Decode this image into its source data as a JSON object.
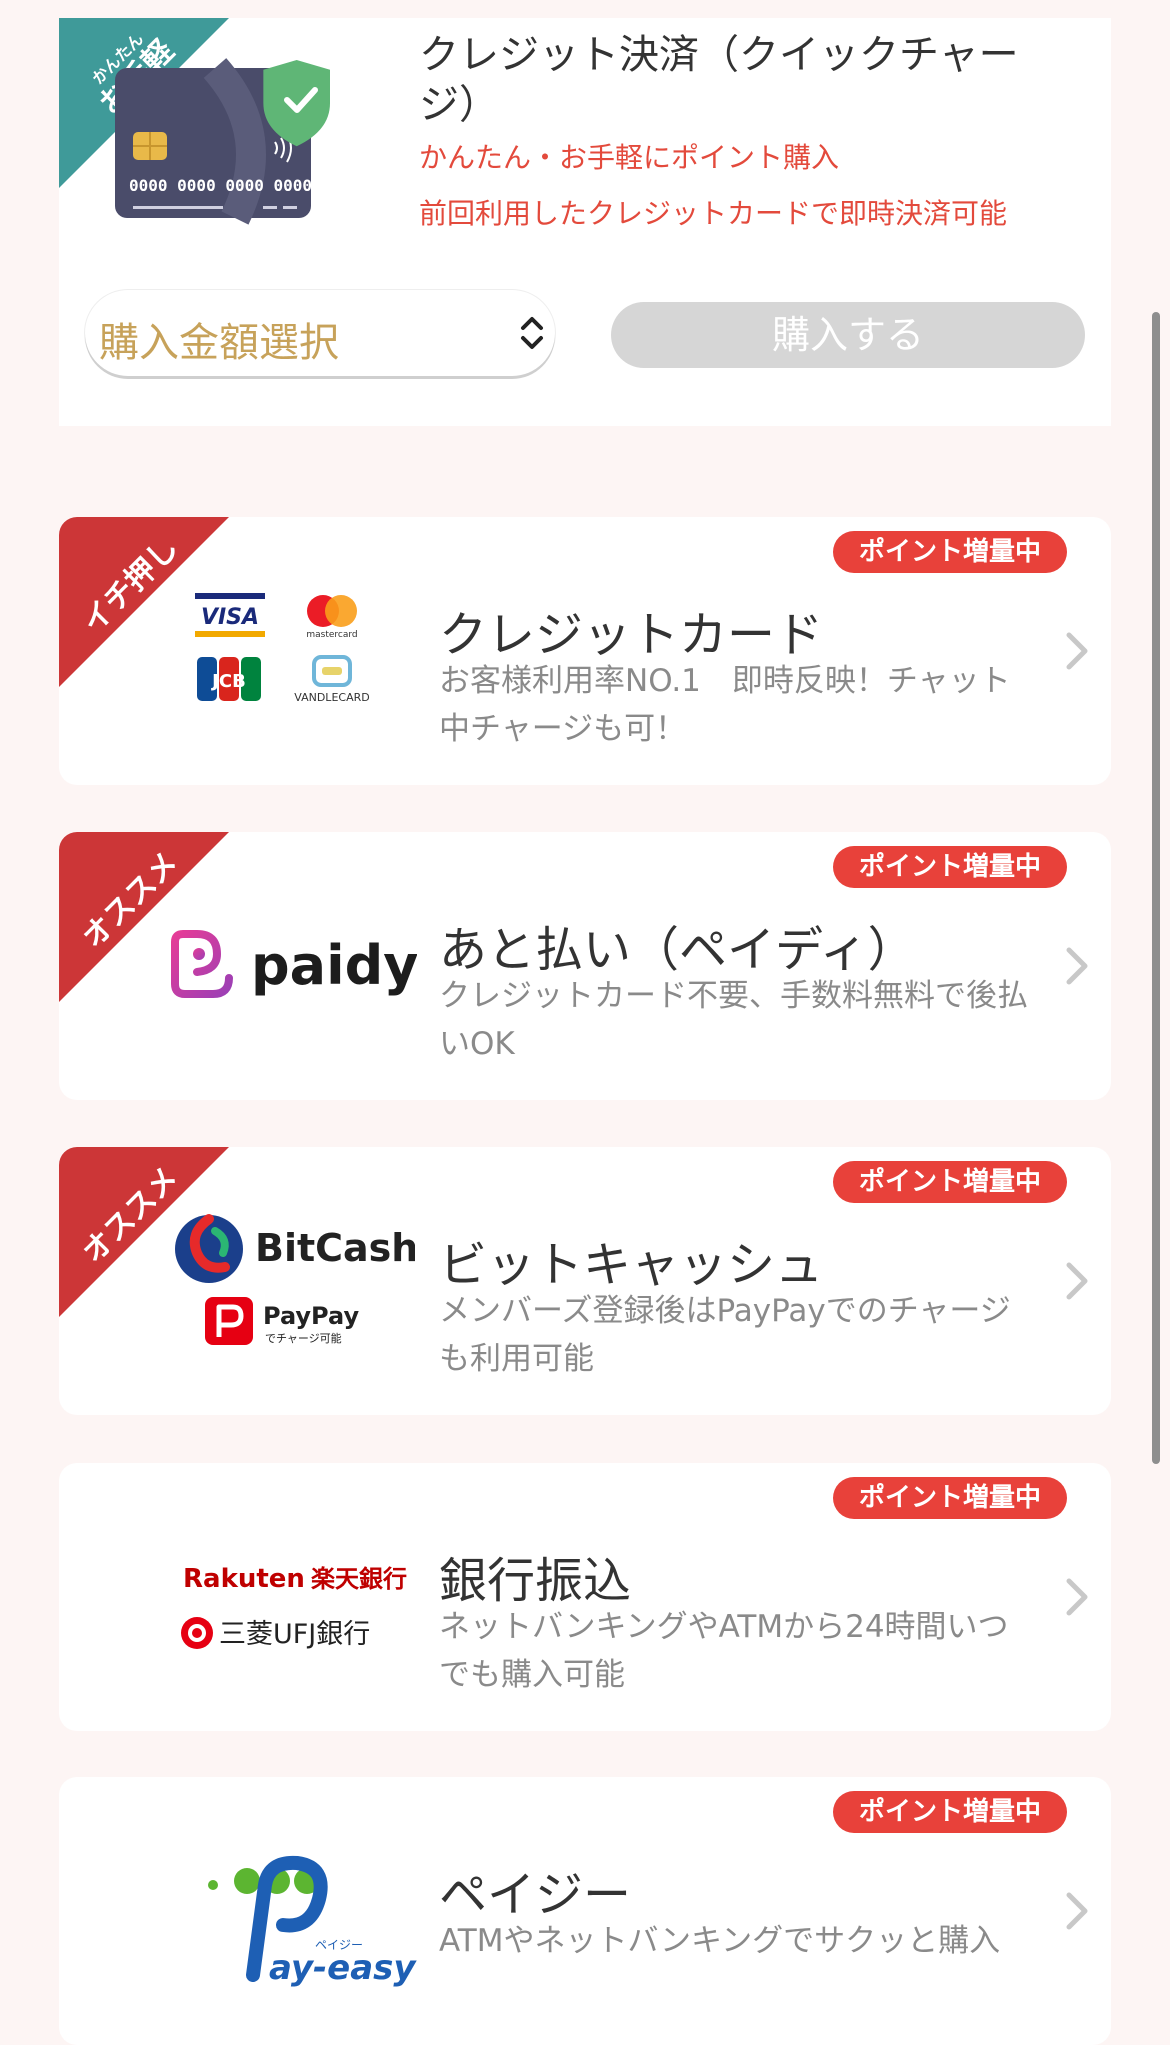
{
  "quick_charge": {
    "corner_small": "かんたん",
    "corner_big": "お手軽",
    "card_number": "0000 0000 0000 0000",
    "title": "クレジット決済（クイックチャージ）",
    "subtitle1": "かんたん・お手軽にポイント購入",
    "subtitle2": "前回利用したクレジットカードで即時決済可能",
    "amount_select_label": "購入金額選択",
    "buy_button_label": "購入する"
  },
  "payment_methods": [
    {
      "corner": "イチ押し",
      "badge": "ポイント増量中",
      "title": "クレジットカード",
      "description": "お客様利用率NO.1　即時反映！チャット中チャージも可！",
      "logos": {
        "visa": "VISA",
        "mastercard": "mastercard",
        "jcb": "JCB",
        "vandle": "VANDLECARD"
      }
    },
    {
      "corner": "オススメ",
      "badge": "ポイント増量中",
      "title": "あと払い（ペイディ）",
      "description": "クレジットカード不要、手数料無料で後払いOK",
      "logos": {
        "paidy": "paidy"
      }
    },
    {
      "corner": "オススメ",
      "badge": "ポイント増量中",
      "title": "ビットキャッシュ",
      "description": "メンバーズ登録後はPayPayでのチャージも利用可能",
      "logos": {
        "bitcash": "BitCash",
        "paypay": "PayPay",
        "paypay_sub": "でチャージ可能"
      }
    },
    {
      "corner": "",
      "badge": "ポイント増量中",
      "title": "銀行振込",
      "description": "ネットバンキングやATMから24時間いつでも購入可能",
      "logos": {
        "rakuten_en": "Rakuten",
        "rakuten_jp": "楽天銀行",
        "mufg": "三菱UFJ銀行"
      }
    },
    {
      "corner": "",
      "badge": "ポイント増量中",
      "title": "ペイジー",
      "description": "ATMやネットバンキングでサクッと購入",
      "logos": {
        "payeasy_small": "ペイジー",
        "payeasy": "ay-easy"
      }
    }
  ],
  "colors": {
    "background": "#fdf5f4",
    "badge": "#e8413a",
    "corner_red": "#cc3637",
    "corner_teal": "#3f9a99",
    "quick_subtitle": "#e34a3c",
    "select_label": "#c7a25a"
  }
}
